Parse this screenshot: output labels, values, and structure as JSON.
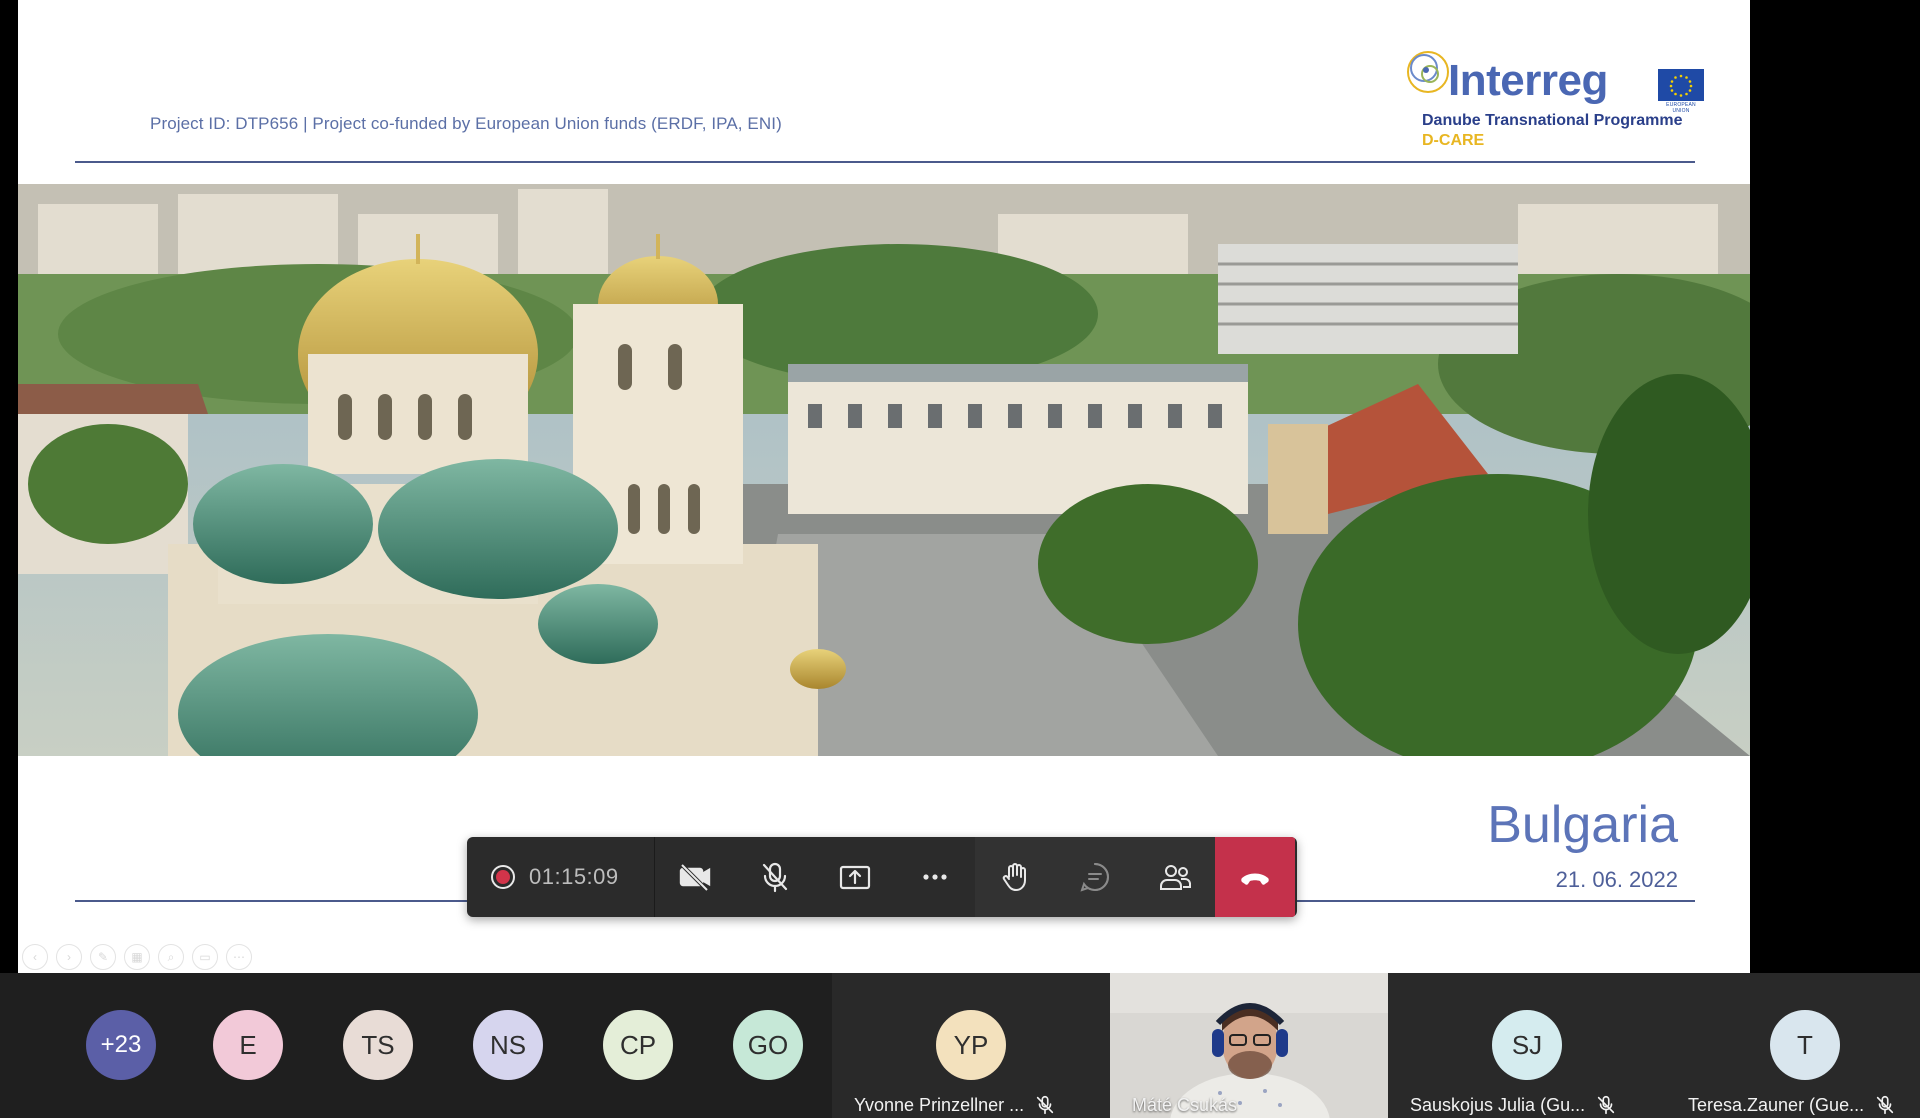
{
  "slide": {
    "header_text": "Project ID: DTP656 | Project co-funded by European Union funds (ERDF, IPA, ENI)",
    "logo": {
      "word": "Interreg",
      "subtitle": "Danube Transnational Programme",
      "tag": "D-CARE",
      "flag_caption": "EUROPEAN UNION"
    },
    "title": "Bulgaria",
    "date": "21. 06. 2022"
  },
  "call_bar": {
    "timer": "01:15:09",
    "buttons": {
      "camera": "camera-off-icon",
      "mic": "mic-off-icon",
      "share": "share-screen-icon",
      "more": "more-icon",
      "raise_hand": "raise-hand-icon",
      "chat": "chat-icon",
      "people": "people-icon",
      "hangup": "hang-up-icon"
    },
    "colors": {
      "bar": "#2b2b2b",
      "hangup": "#c4314b",
      "record": "#d2344a"
    }
  },
  "participants": {
    "overflow": "+23",
    "avatars": [
      {
        "initials": "E",
        "color": "#f2c9d8"
      },
      {
        "initials": "TS",
        "color": "#e8dcd6"
      },
      {
        "initials": "NS",
        "color": "#d6d5ee"
      },
      {
        "initials": "CP",
        "color": "#e4eed8"
      },
      {
        "initials": "GO",
        "color": "#c6e8d7"
      }
    ],
    "tiles": [
      {
        "initials": "YP",
        "name": "Yvonne Prinzellner ...",
        "color": "#f3e1bd",
        "muted": true
      },
      {
        "initials": "",
        "name": "Máté Csukás",
        "video": true,
        "muted": false
      },
      {
        "initials": "SJ",
        "name": "Sauskojus Julia (Gu...",
        "color": "#d5ecef",
        "muted": true
      },
      {
        "initials": "T",
        "name": "Teresa.Zauner (Gue...",
        "color": "#d9e6ee",
        "muted": true
      }
    ],
    "overflow_color": "#5b5fa7"
  }
}
